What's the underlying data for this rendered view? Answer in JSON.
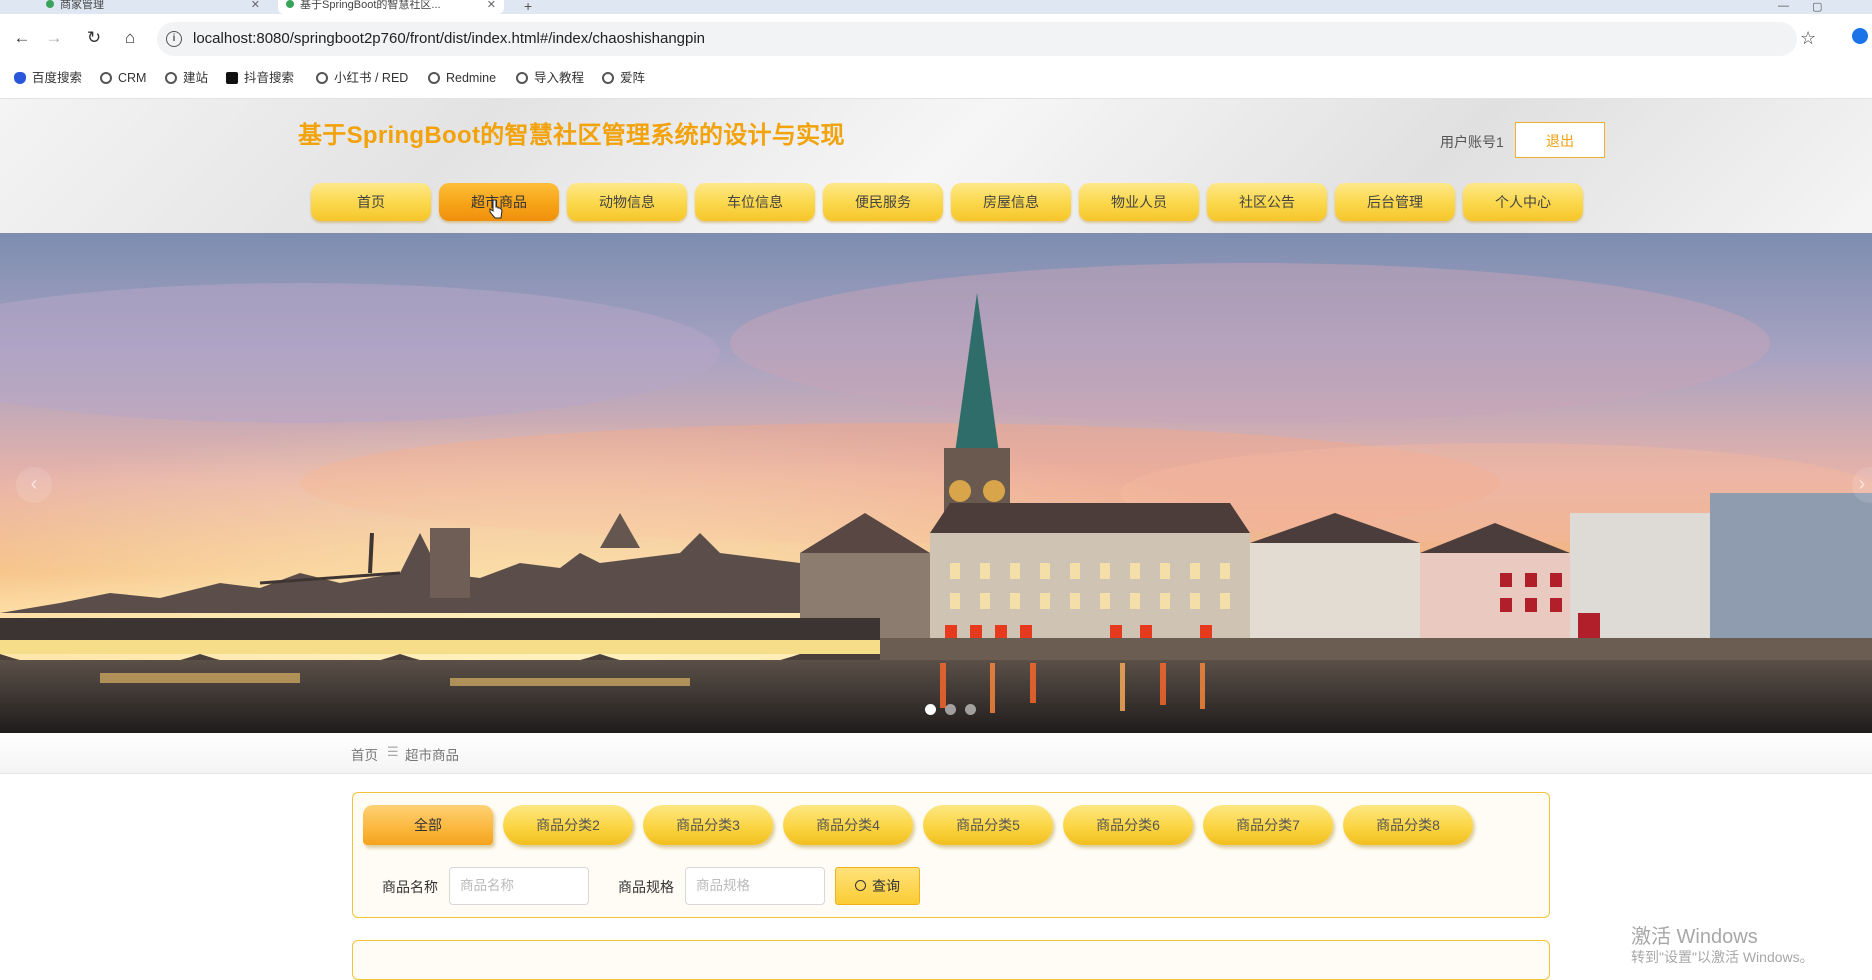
{
  "browser": {
    "tabs": [
      {
        "label": "商家管理"
      },
      {
        "label": "基于SpringBoot的智慧社区..."
      }
    ],
    "url": "localhost:8080/springboot2p760/front/dist/index.html#/index/chaoshishangpin",
    "bookmarks": [
      "百度搜索",
      "CRM",
      "建站",
      "抖音搜索",
      "小红书 / RED",
      "Redmine",
      "导入教程",
      "爱阵"
    ]
  },
  "header": {
    "title": "基于SpringBoot的智慧社区管理系统的设计与实现",
    "account": "用户账号1",
    "logout": "退出"
  },
  "nav": {
    "items": [
      "首页",
      "超市商品",
      "动物信息",
      "车位信息",
      "便民服务",
      "房屋信息",
      "物业人员",
      "社区公告",
      "后台管理",
      "个人中心"
    ],
    "active": "超市商品"
  },
  "banner": {
    "slide_count": 3,
    "active_slide": 1
  },
  "breadcrumb": {
    "home": "首页",
    "separator": "☰",
    "current": "超市商品"
  },
  "filters": {
    "categories": [
      "全部",
      "商品分类2",
      "商品分类3",
      "商品分类4",
      "商品分类5",
      "商品分类6",
      "商品分类7",
      "商品分类8"
    ],
    "active_category": "全部",
    "name_label": "商品名称",
    "name_placeholder": "商品名称",
    "spec_label": "商品规格",
    "spec_placeholder": "商品规格",
    "search_label": "查询"
  },
  "watermark": {
    "line1": "激活 Windows",
    "line2": "转到\"设置\"以激活 Windows。"
  },
  "colors": {
    "title": "#f2a20a",
    "nav_yellow": "#fbd94e",
    "nav_active": "#f8a61a",
    "panel_border": "#f4c33a"
  }
}
